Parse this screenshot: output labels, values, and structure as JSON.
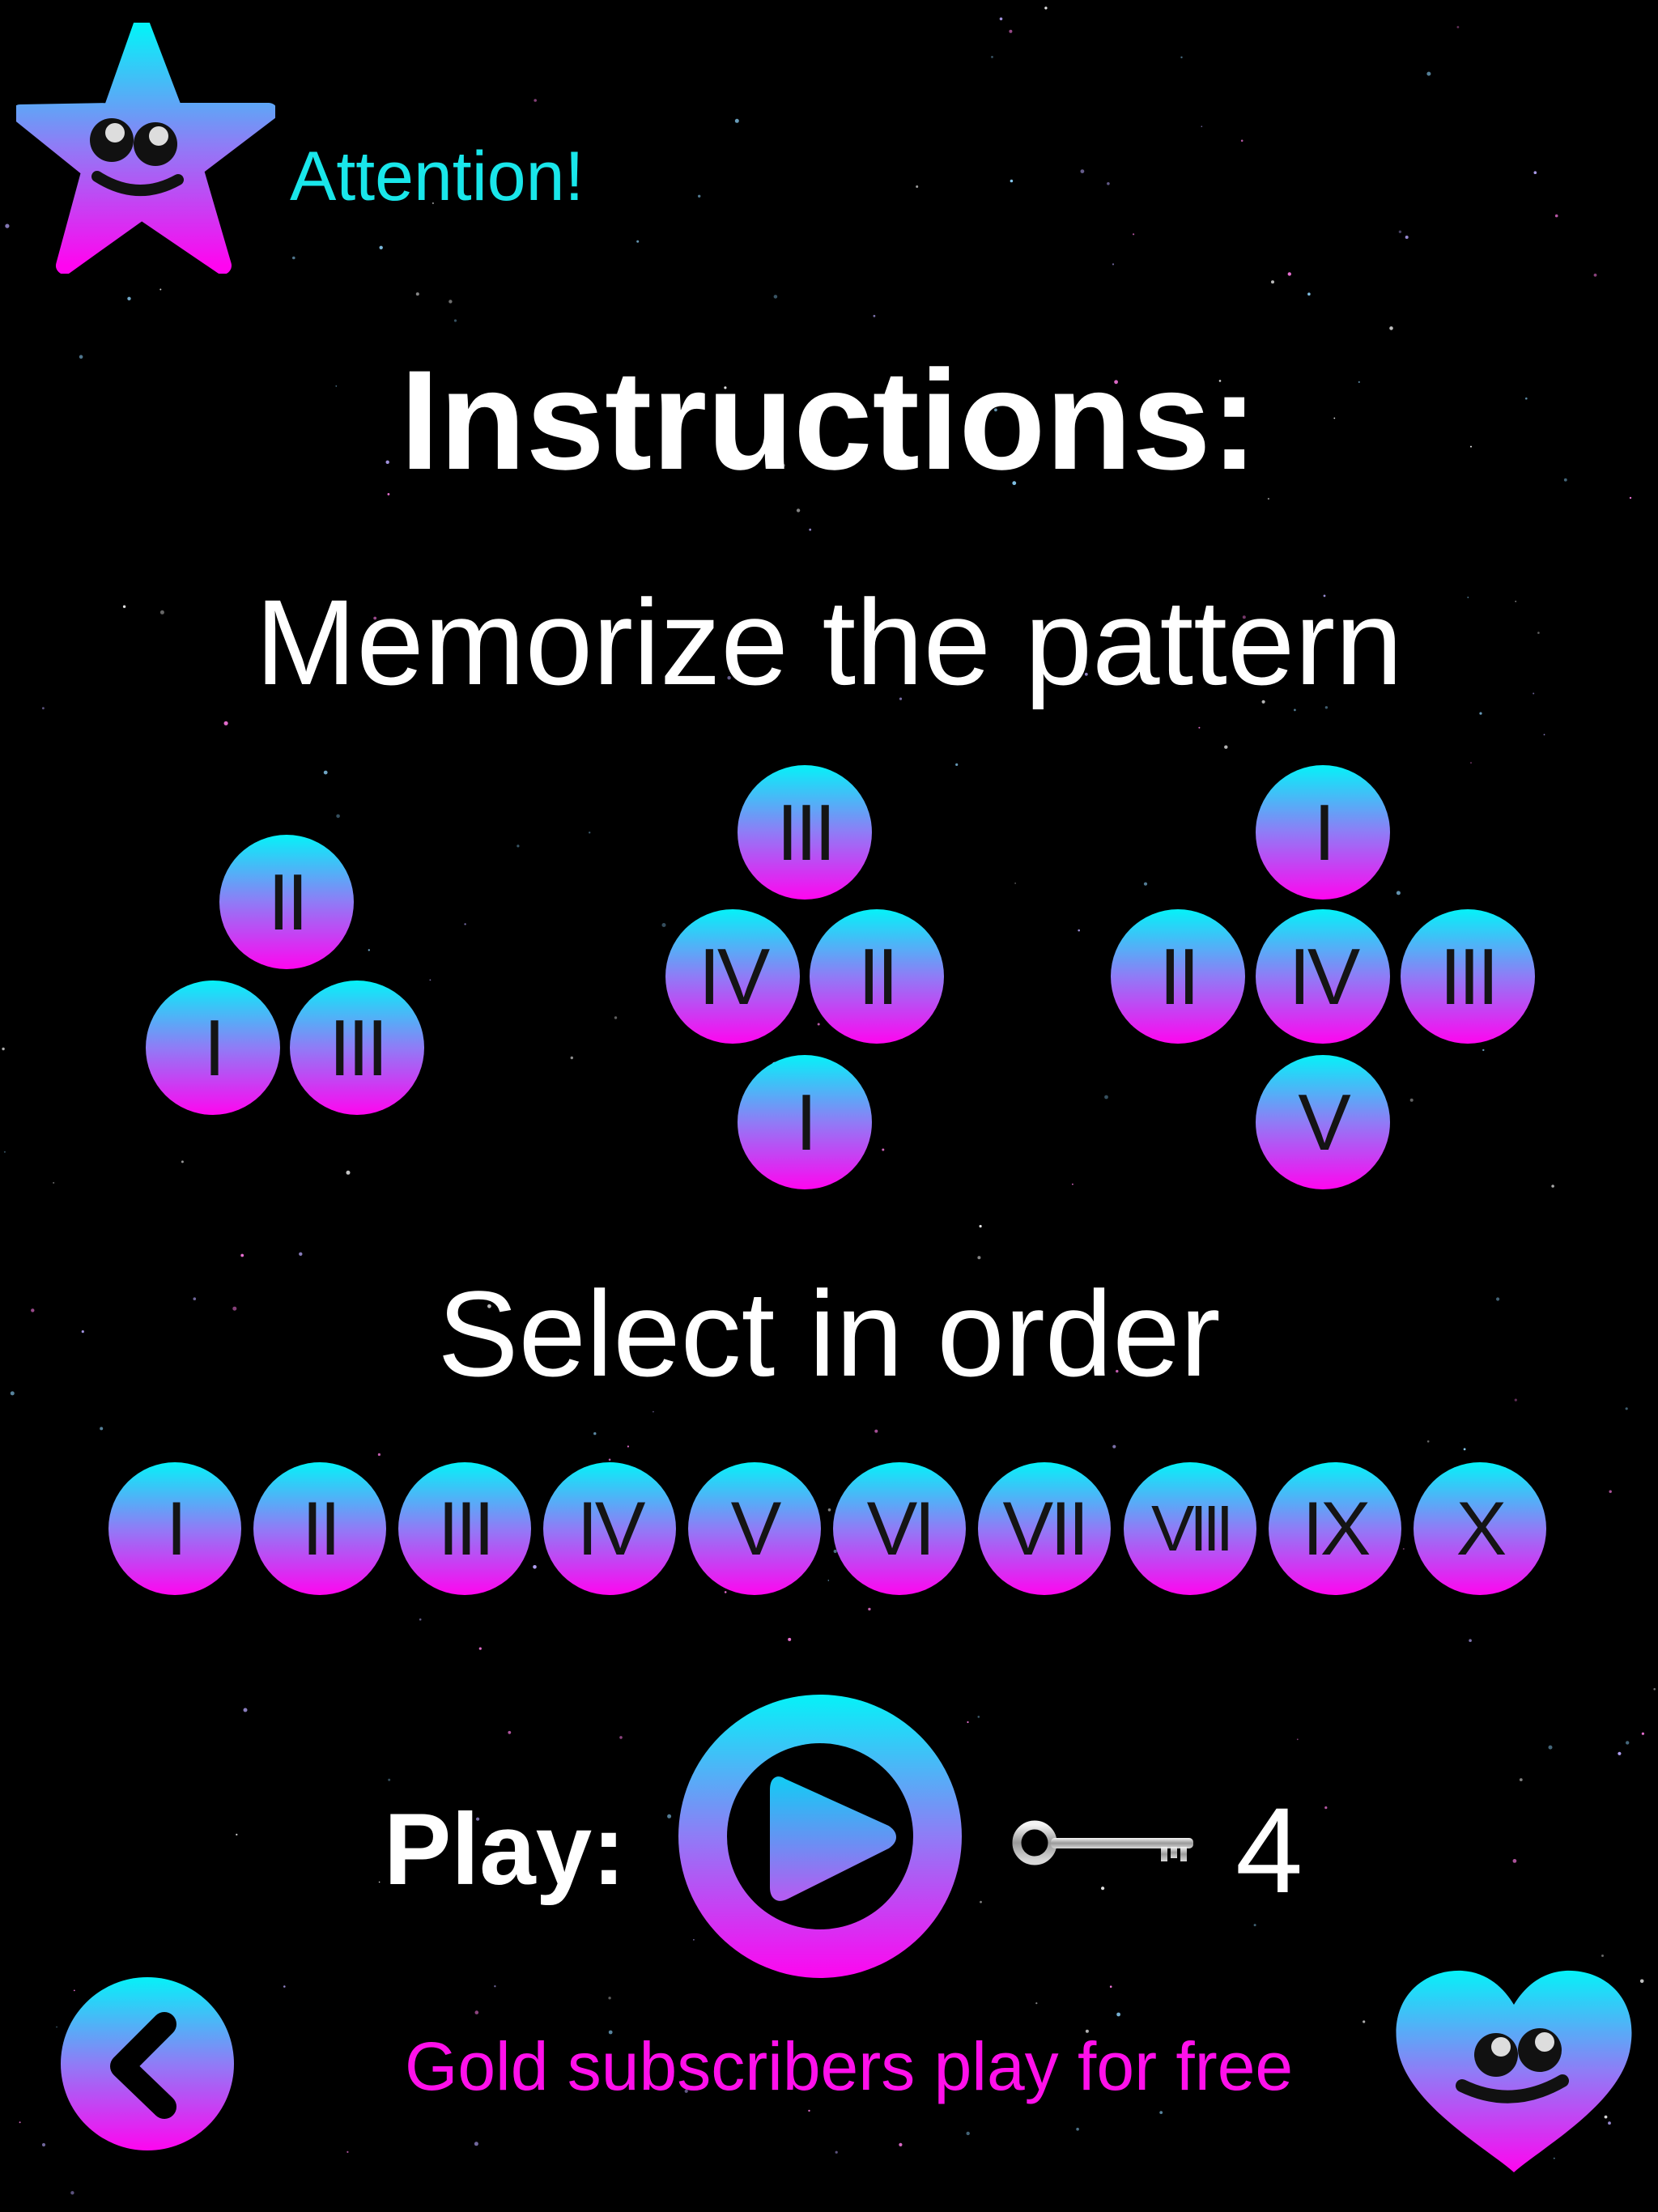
{
  "header": {
    "icon": "star-face-icon",
    "label": "Attention!"
  },
  "title": "Instructions:",
  "step1": "Memorize the pattern",
  "patterns": [
    [
      "II",
      "I",
      "III"
    ],
    [
      "III",
      "IV",
      "II",
      "I"
    ],
    [
      "I",
      "II",
      "IV",
      "III",
      "V"
    ]
  ],
  "step2": "Select in order",
  "order": [
    "I",
    "II",
    "III",
    "IV",
    "V",
    "VI",
    "VII",
    "VIII",
    "IX",
    "X"
  ],
  "play": {
    "label": "Play:",
    "button_icon": "play-icon",
    "key_icon": "key-icon",
    "key_count": "4"
  },
  "promo": "Gold subscribers play for free",
  "nav": {
    "back_icon": "chevron-left-icon",
    "heart_icon": "heart-face-icon"
  },
  "colors": {
    "gradient_top": "#05f2f8",
    "gradient_bottom": "#ff05f0",
    "accent_cyan": "#19e6ea",
    "accent_magenta": "#ff10ea",
    "background": "#000000"
  }
}
